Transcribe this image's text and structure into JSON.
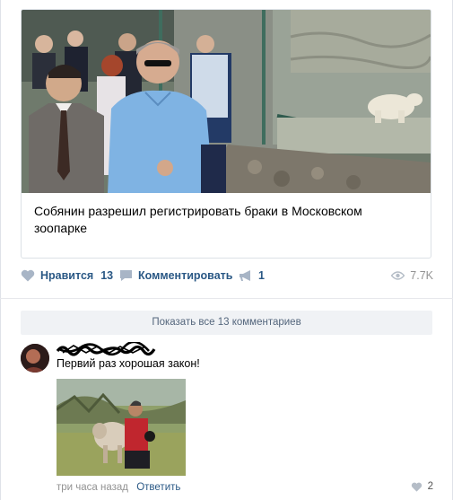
{
  "post": {
    "article_title": "Собянин разрешил регистрировать браки в Московском зоопарке",
    "photo_icon": "photo-of-officials-walking-past-polar-bear-enclosure"
  },
  "actions": {
    "like_label": "Нравится",
    "like_count": "13",
    "comment_label": "Комментировать",
    "share_count": "1",
    "views": "7.7K",
    "like_icon": "heart-icon",
    "comment_icon": "comment-icon",
    "share_icon": "megaphone-icon",
    "views_icon": "eye-icon"
  },
  "comments": {
    "show_all_label": "Показать все 13 комментариев",
    "items": [
      {
        "text": "Первий раз хорошая закон!",
        "time": "три часа назад",
        "reply_label": "Ответить",
        "likes": "2",
        "photo_icon": "photo-of-man-hugging-sheep"
      }
    ]
  },
  "colors": {
    "link_blue": "#2a5885",
    "muted_gray": "#939393",
    "button_bg": "#f0f2f5",
    "border": "#dce1e6"
  }
}
